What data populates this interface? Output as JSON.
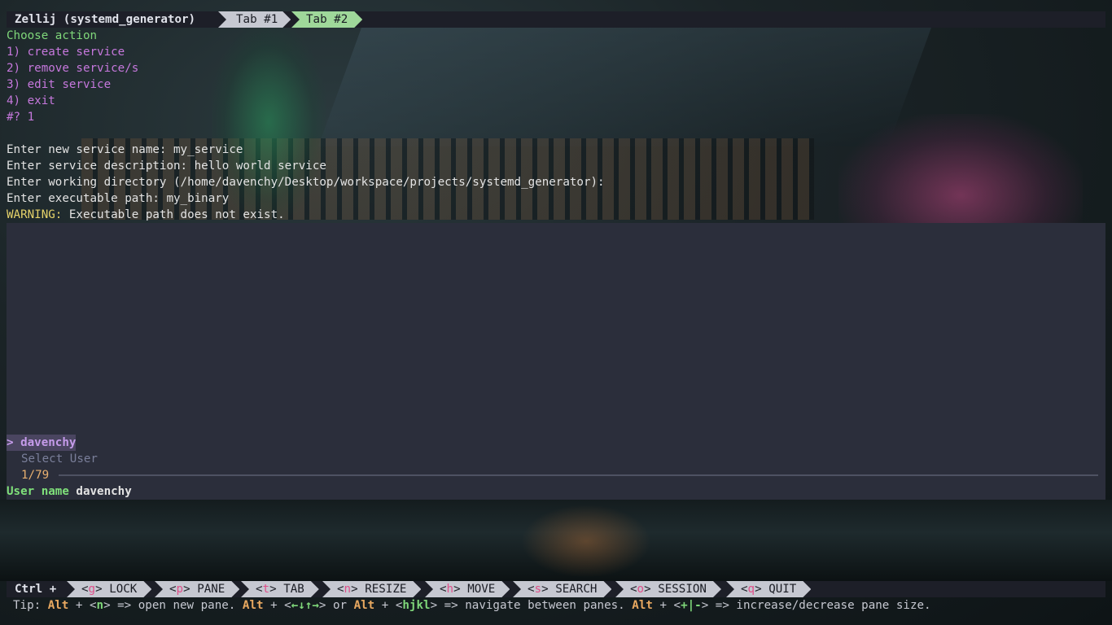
{
  "tabbar": {
    "session_title": "Zellij (systemd_generator)",
    "tabs": [
      {
        "label": "Tab #1"
      },
      {
        "label": "Tab #2"
      }
    ]
  },
  "terminal": {
    "menu_title": "Choose action",
    "options": [
      "1) create service",
      "2) remove service/s",
      "3) edit service",
      "4) exit"
    ],
    "selection_prompt": "#? 1",
    "lines": [
      "Enter new service name: my_service",
      "Enter service description: hello world service",
      "Enter working directory (/home/davenchy/Desktop/workspace/projects/systemd_generator):",
      "Enter executable path: my_binary"
    ],
    "warning_label": "WARNING:",
    "warning_text": " Executable path does not exist."
  },
  "picker": {
    "selected_item": "> davenchy",
    "header": "Select User",
    "count": "1/79",
    "input_label": "User name",
    "input_value": "davenchy"
  },
  "statusbar": {
    "modifier": "Ctrl +",
    "keys": [
      {
        "key": "g",
        "label": "LOCK"
      },
      {
        "key": "p",
        "label": "PANE"
      },
      {
        "key": "t",
        "label": "TAB"
      },
      {
        "key": "n",
        "label": "RESIZE"
      },
      {
        "key": "h",
        "label": "MOVE"
      },
      {
        "key": "s",
        "label": "SEARCH"
      },
      {
        "key": "o",
        "label": "SESSION"
      },
      {
        "key": "q",
        "label": "QUIT"
      }
    ]
  },
  "tip": {
    "prefix": "Tip: ",
    "alt": "Alt",
    "plus": " + <",
    "n": "n",
    "t1": "> => open new pane. ",
    "arrows": "←↓↑→",
    "t2": "> or ",
    "hjkl": "hjkl",
    "t3": "> => navigate between panes. ",
    "plusminus": "+|-",
    "t4": "> => increase/decrease pane size."
  },
  "colors": {
    "accent_green": "#9fd89a",
    "key_bg": "#c6c8d1",
    "key_letter": "#e0508a",
    "menu_magenta": "#c678dd",
    "warning_yellow": "#e5d26a"
  }
}
